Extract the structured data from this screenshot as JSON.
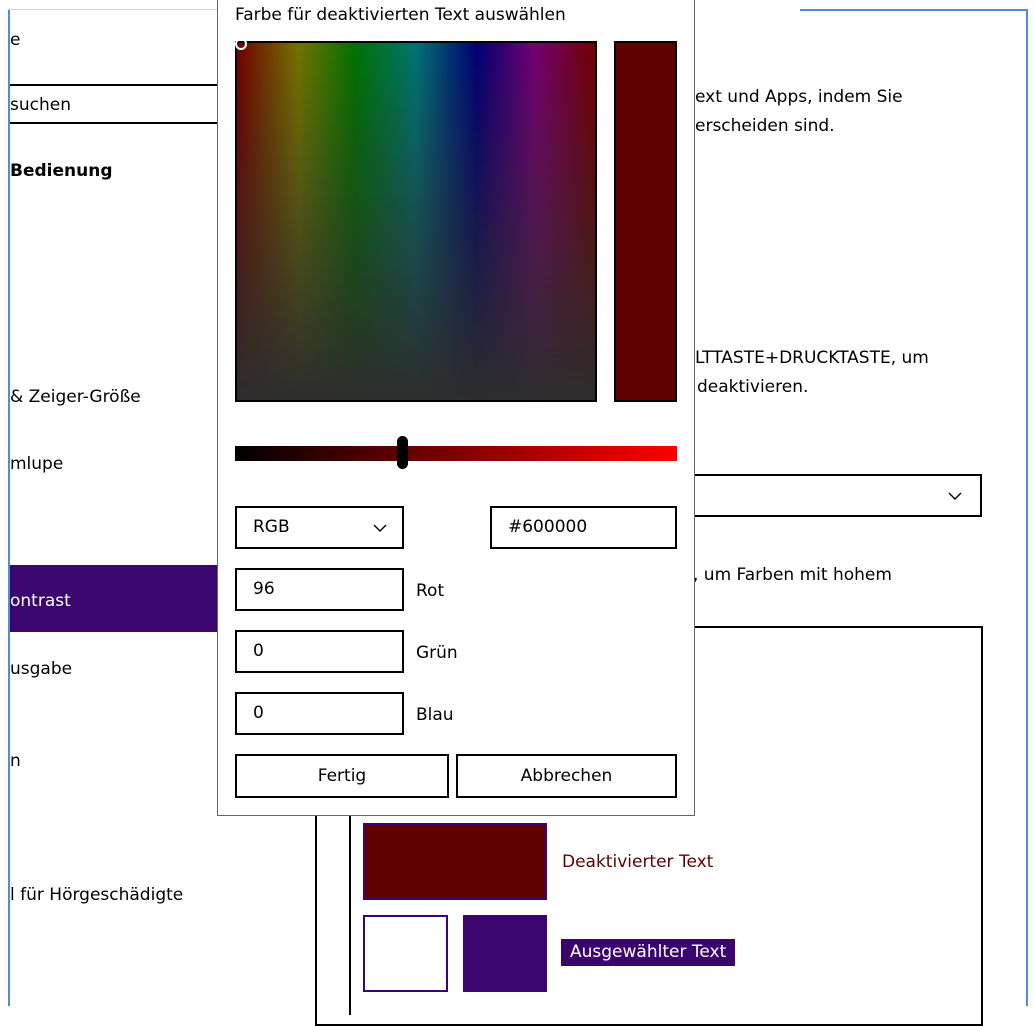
{
  "sidebar": {
    "header_fragment": "e",
    "search_placeholder": "suchen",
    "section_title": "Bedienung",
    "items": [
      {
        "label": "& Zeiger-Größe"
      },
      {
        "label": "mlupe"
      },
      {
        "label": "ontrast"
      },
      {
        "label": "usgabe"
      },
      {
        "label": "n"
      },
      {
        "label": "l für Hörgeschädigte"
      }
    ]
  },
  "main": {
    "intro_line1": "ext und Apps, indem Sie",
    "intro_line2": "erscheiden sind.",
    "shortcut_line1": "LTTASTE+DRUCKTASTE, um",
    "shortcut_line2": "deaktivieren.",
    "instruction": ", um Farben mit hohem",
    "preview": {
      "disabled_text_label": "Deaktivierter Text",
      "selected_text_label": "Ausgewählter Text",
      "disabled_color": "#600000",
      "accent_color": "#3b0570"
    }
  },
  "dialog": {
    "title": "Farbe für deaktivierten Text auswählen",
    "mode": "RGB",
    "hex_value": "#600000",
    "red_value": "96",
    "red_label": "Rot",
    "green_value": "0",
    "green_label": "Grün",
    "blue_value": "0",
    "blue_label": "Blau",
    "done_button": "Fertig",
    "cancel_button": "Abbrechen",
    "current_color": "#600000"
  }
}
